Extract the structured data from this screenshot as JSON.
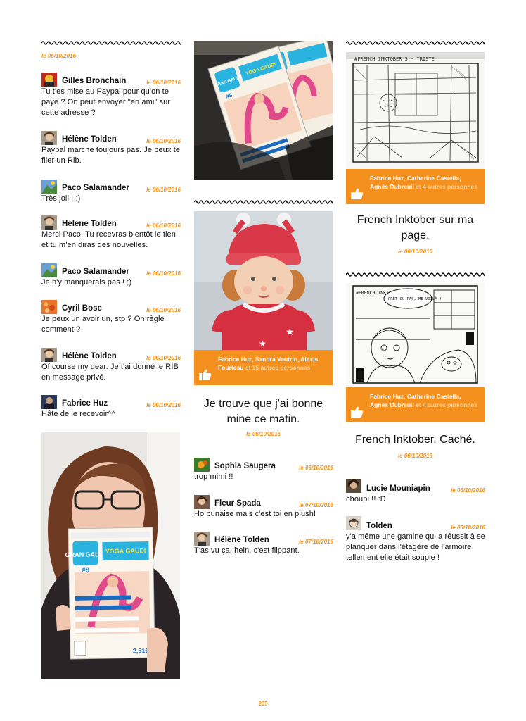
{
  "page_number": "205",
  "colors": {
    "accent": "#f4901e",
    "date": "#f0921a"
  },
  "left": {
    "top_date": "le 06/10/2016",
    "comments": [
      {
        "author": "Gilles Bronchain",
        "date": "le 06/10/2016",
        "text": "Tu t'es mise au Paypal pour qu'on te paye ? On peut envoyer \"en ami\" sur cette adresse ?"
      },
      {
        "author": "Hélène Tolden",
        "date": "le 06/10/2016",
        "text": "Paypal marche toujours pas. Je peux te filer un Rib."
      },
      {
        "author": "Paco Salamander",
        "date": "le 06/10/2016",
        "text": "Très joli ! ;)"
      },
      {
        "author": "Hélène Tolden",
        "date": "le 06/10/2016",
        "text": "Merci Paco. Tu recevras bientôt le tien et tu m'en diras des nouvelles."
      },
      {
        "author": "Paco Salamander",
        "date": "le 06/10/2016",
        "text": "Je n'y manquerais pas ! ;)"
      },
      {
        "author": "Cyril Bosc",
        "date": "le 06/10/2016",
        "text": "Je peux un avoir un, stp ? On règle comment ?"
      },
      {
        "author": "Hélène Tolden",
        "date": "le 06/10/2016",
        "text": "Of course my dear. Je t'ai donné le RIB en message privé."
      },
      {
        "author": "Fabrice Huz",
        "date": "le 06/10/2016",
        "text": "Hâte de le recevoir^^"
      }
    ],
    "selfie_magazine": {
      "logo": "GRAN GAUDI",
      "issue": "#8",
      "title": "YOGA GAUDI",
      "price": "2,51€"
    }
  },
  "middle": {
    "magazine_stack": {
      "logo": "GRAN GAUDI",
      "issue": "#8",
      "title": "YOGA GAUDI"
    },
    "doll_post": {
      "likes_names": "Fabrice Huz, Sandra Vautrin, Alexis Fourteau",
      "likes_others": "et 15 autres personnes",
      "caption": "Je trouve que j'ai bonne mine ce matin.",
      "date": "le 06/10/2016"
    },
    "comments": [
      {
        "author": "Sophia Saugera",
        "date": "le 06/10/2016",
        "text": "trop mimi !!"
      },
      {
        "author": "Fleur Spada",
        "date": "le 07/10/2016",
        "text": "Ho punaise mais c'est toi en plush!"
      },
      {
        "author": "Hélène Tolden",
        "date": "le 07/10/2016",
        "text": "T'as vu ça, hein, c'est flippant."
      }
    ]
  },
  "right": {
    "post1": {
      "sketch_text": "#FRENCH INKTOBER 5 - TRISTE",
      "likes_names": "Fabrice Huz, Catherine Castella, Agnès Dubreuil",
      "likes_others": "et 4 autres personnes",
      "caption": "French Inktober sur ma page.",
      "date": "le 06/10/2016"
    },
    "post2": {
      "sketch_text1": "#FRENCH INKTOBER 6 CACHÉ",
      "sketch_text2": "PRÊT OU PAS, ME VOILÀ !",
      "likes_names": "Fabrice Huz, Catherine Castella, Agnès Dubreuil",
      "likes_others": "et 4 autres personnes",
      "caption": "French Inktober. Caché.",
      "date": "le 06/10/2016"
    },
    "comments": [
      {
        "author": "Lucie Mouniapin",
        "date": "le 06/10/2016",
        "text": "choupi !! :D"
      },
      {
        "author": "Tolden",
        "date": "le 06/10/2016",
        "text": "y'a même une gamine qui a réussit à se planquer dans l'étagère de l'armoire tellement elle était souple !"
      }
    ]
  }
}
